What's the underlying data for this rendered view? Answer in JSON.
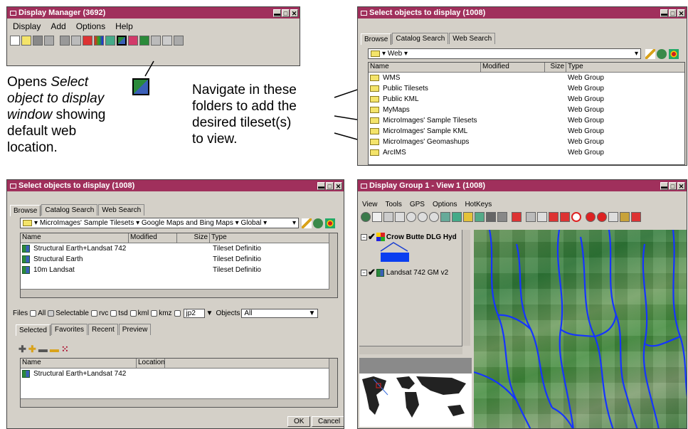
{
  "display_manager": {
    "title": "Display Manager (3692)",
    "menu": [
      "Display",
      "Add",
      "Options",
      "Help"
    ]
  },
  "annotation_left": {
    "line1": "Opens ",
    "line1_italic": "Select",
    "line2_italic": "object to display",
    "line3_italic": "window",
    "line3_rest": " showing",
    "line4": "default web",
    "line5": "location."
  },
  "annotation_mid": {
    "lines": [
      "Navigate in these",
      "folders to add the",
      "desired tileset(s)",
      "to view."
    ]
  },
  "select_top": {
    "title": "Select objects to display (1008)",
    "tabs": [
      "Browse",
      "Catalog Search",
      "Web Search"
    ],
    "path": "Web",
    "columns": [
      "Name",
      "Modified",
      "Size",
      "Type"
    ],
    "rows": [
      {
        "name": "WMS",
        "type": "Web Group"
      },
      {
        "name": "Public Tilesets",
        "type": "Web Group"
      },
      {
        "name": "Public KML",
        "type": "Web Group"
      },
      {
        "name": "MyMaps",
        "type": "Web Group"
      },
      {
        "name": "MicroImages' Sample Tilesets",
        "type": "Web Group"
      },
      {
        "name": "MicroImages' Sample KML",
        "type": "Web Group"
      },
      {
        "name": "MicroImages' Geomashups",
        "type": "Web Group"
      },
      {
        "name": "ArcIMS",
        "type": "Web Group"
      }
    ]
  },
  "select_bottom": {
    "title": "Select objects to display (1008)",
    "tabs": [
      "Browse",
      "Catalog Search",
      "Web Search"
    ],
    "path": "MicroImages' Sample Tilesets  ▾ Google Maps and Bing Maps  ▾ Global",
    "columns": [
      "Name",
      "Modified",
      "Size",
      "Type"
    ],
    "rows": [
      {
        "name": "Structural Earth+Landsat 742",
        "type": "Tileset Definitio"
      },
      {
        "name": "Structural Earth",
        "type": "Tileset Definitio"
      },
      {
        "name": "10m Landsat",
        "type": "Tileset Definitio"
      }
    ],
    "filter": {
      "files_label": "Files",
      "options": [
        "All",
        "Selectable",
        "rvc",
        "tsd",
        "kml",
        "kmz"
      ],
      "ext_value": "jp2",
      "objects_label": "Objects",
      "objects_value": "All"
    },
    "sel_tabs": [
      "Selected",
      "Favorites",
      "Recent",
      "Preview"
    ],
    "sel_columns": [
      "Name",
      "Location"
    ],
    "sel_rows": [
      {
        "name": "Structural Earth+Landsat 742"
      }
    ],
    "ok_label": "OK",
    "cancel_label": "Cancel"
  },
  "display_group": {
    "title": "Display Group 1 - View 1 (1008)",
    "menu": [
      "View",
      "Tools",
      "GPS",
      "Options",
      "HotKeys"
    ],
    "layers": [
      {
        "name": "Crow Butte DLG Hyd"
      },
      {
        "name": "Landsat 742 GM v2"
      }
    ]
  }
}
